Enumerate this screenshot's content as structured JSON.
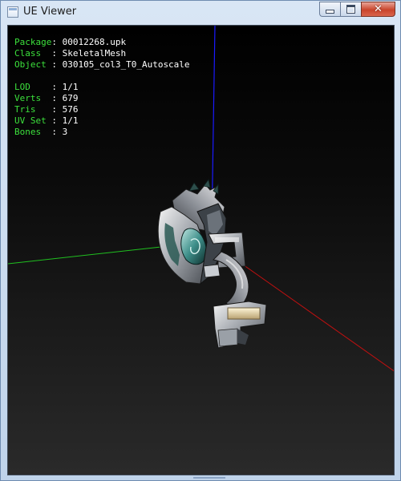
{
  "window": {
    "title": "UE Viewer",
    "close_glyph": "✕"
  },
  "info": {
    "package": {
      "label": "Package",
      "value": "00012268.upk"
    },
    "class": {
      "label": "Class  ",
      "value": "SkeletalMesh"
    },
    "object": {
      "label": "Object ",
      "value": "030105_col3_T0_Autoscale"
    },
    "lod": {
      "label": "LOD    ",
      "value": "1/1"
    },
    "verts": {
      "label": "Verts  ",
      "value": "679"
    },
    "tris": {
      "label": "Tris   ",
      "value": "576"
    },
    "uvset": {
      "label": "UV Set ",
      "value": "1/1"
    },
    "bones": {
      "label": "Bones  ",
      "value": "3"
    }
  },
  "separator": ": ",
  "colors": {
    "label": "#3ce03c",
    "value": "#ffffff",
    "axis_x": "#c01010",
    "axis_y": "#20c020",
    "axis_z": "#1a1aff"
  }
}
